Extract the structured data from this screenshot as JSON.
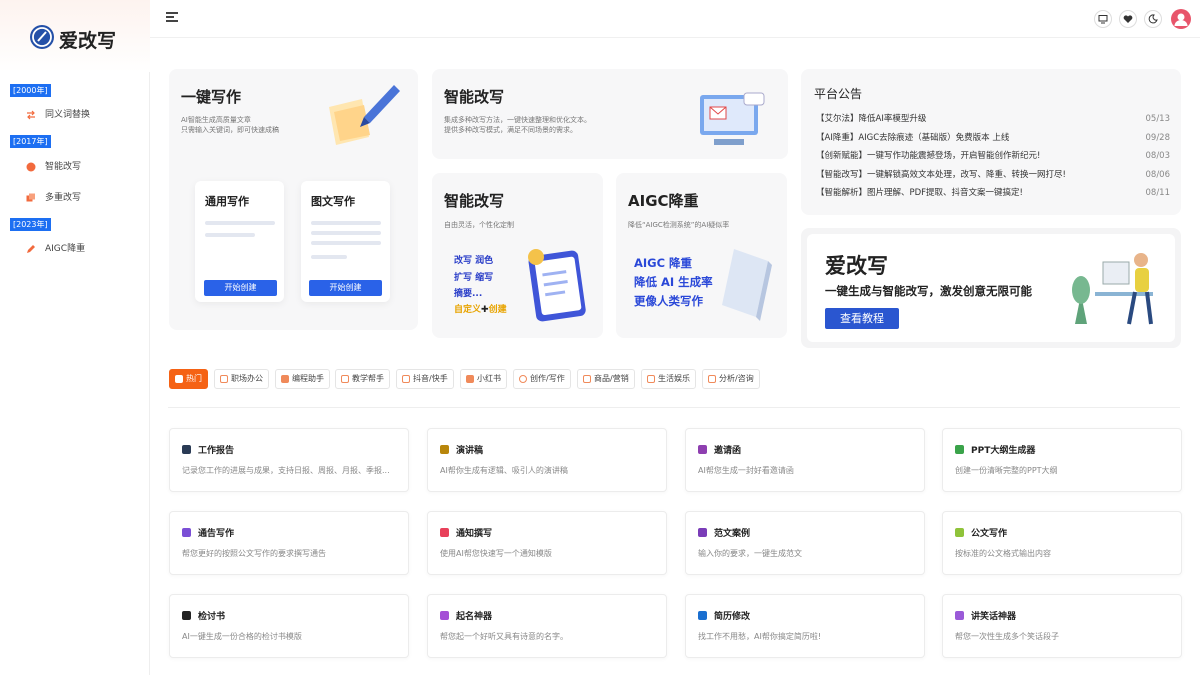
{
  "app": {
    "name": "爱改写"
  },
  "sidebar": {
    "groups": [
      {
        "tag": "[2000年]",
        "items": [
          {
            "label": "同义词替换",
            "icon": "swap-icon",
            "color": "#f26a3d"
          }
        ]
      },
      {
        "tag": "[2017年]",
        "items": [
          {
            "label": "智能改写",
            "icon": "brain-icon",
            "color": "#f26a3d"
          },
          {
            "label": "多重改写",
            "icon": "layers-icon",
            "color": "#f26a3d"
          }
        ]
      },
      {
        "tag": "[2023年]",
        "items": [
          {
            "label": "AIGC降重",
            "icon": "pencil-icon",
            "color": "#f26a3d"
          }
        ]
      }
    ]
  },
  "topbar": {
    "icons": [
      "menu-icon",
      "monitor-icon",
      "heart-icon",
      "moon-icon",
      "user-avatar-icon"
    ]
  },
  "hero": {
    "write": {
      "title": "一键写作",
      "sub1": "AI智能生成高质量文章",
      "sub2": "只需输入关键词，即可快速成稿",
      "cards": [
        {
          "title": "通用写作",
          "button": "开始创建"
        },
        {
          "title": "图文写作",
          "button": "开始创建"
        }
      ]
    },
    "rewrite_top": {
      "title": "智能改写",
      "sub1": "集成多种改写方法，一键快速整理和优化文本。",
      "sub2": "提供多种改写模式，满足不同场景的需求。"
    },
    "rewrite_small": {
      "title": "智能改写",
      "sub": "自由灵活，个性化定制",
      "lines": [
        "改写 润色",
        "扩写 缩写",
        "摘要...",
        "自定义",
        "创建"
      ]
    },
    "aigc": {
      "title": "AIGC降重",
      "sub": "降低“AIGC检测系统”的AI疑似率",
      "lines": [
        "AIGC 降重",
        "降低 AI 生成率",
        "更像人类写作"
      ]
    }
  },
  "announcements": {
    "title": "平台公告",
    "items": [
      {
        "text": "【艾尔法】降低AI率模型升级",
        "date": "05/13"
      },
      {
        "text": "【AI降重】AIGC去除痕迹（基础版）免费版本 上线",
        "date": "09/28"
      },
      {
        "text": "【创新赋能】一键写作功能震撼登场，开启智能创作新纪元!",
        "date": "08/03"
      },
      {
        "text": "【智能改写】一键解锁高效文本处理，改写、降重、转换一网打尽!",
        "date": "08/06"
      },
      {
        "text": "【智能解析】图片理解、PDF提取、抖音文案一键搞定!",
        "date": "08/11"
      }
    ]
  },
  "promo": {
    "title": "爱改写",
    "slogan": "一键生成与智能改写，激发创意无限可能",
    "button": "查看教程"
  },
  "categories": [
    {
      "label": "热门",
      "active": true
    },
    {
      "label": "职场办公"
    },
    {
      "label": "编程助手"
    },
    {
      "label": "教学帮手"
    },
    {
      "label": "抖音/快手"
    },
    {
      "label": "小红书"
    },
    {
      "label": "创作/写作"
    },
    {
      "label": "商品/营销"
    },
    {
      "label": "生活娱乐"
    },
    {
      "label": "分析/咨询"
    }
  ],
  "tools": [
    {
      "title": "工作报告",
      "desc": "记录您工作的进展与成果，支持日报、周报、月报、季报...",
      "icon": "report-icon",
      "color": "#2a3b55"
    },
    {
      "title": "演讲稿",
      "desc": "AI帮你生成有逻辑、吸引人的演讲稿",
      "icon": "speech-icon",
      "color": "#b8860b"
    },
    {
      "title": "邀请函",
      "desc": "AI帮您生成一封好看邀请函",
      "icon": "invitation-icon",
      "color": "#8e3fb0"
    },
    {
      "title": "PPT大纲生成器",
      "desc": "创建一份清晰完整的PPT大纲",
      "icon": "ppt-icon",
      "color": "#3aa34a"
    },
    {
      "title": "通告写作",
      "desc": "帮您更好的按照公文写作的要求撰写通告",
      "icon": "notice-icon",
      "color": "#7b4fd6"
    },
    {
      "title": "通知撰写",
      "desc": "使用AI帮您快速写一个通知模版",
      "icon": "notify-icon",
      "color": "#e8405a"
    },
    {
      "title": "范文案例",
      "desc": "输入你的要求，一键生成范文",
      "icon": "sample-icon",
      "color": "#7a3db8"
    },
    {
      "title": "公文写作",
      "desc": "按标准的公文格式输出内容",
      "icon": "document-icon",
      "color": "#8fc33a"
    },
    {
      "title": "检讨书",
      "desc": "AI一键生成一份合格的检讨书模版",
      "icon": "review-icon",
      "color": "#222222"
    },
    {
      "title": "起名神器",
      "desc": "帮您起一个好听又具有诗意的名字。",
      "icon": "naming-icon",
      "color": "#a44fd6"
    },
    {
      "title": "简历修改",
      "desc": "找工作不用愁，AI帮你搞定简历啦!",
      "icon": "resume-icon",
      "color": "#1a6fd0"
    },
    {
      "title": "讲笑话神器",
      "desc": "帮您一次性生成多个笑话段子",
      "icon": "joke-icon",
      "color": "#9a5ad8"
    }
  ],
  "colors": {
    "accent": "#2a62e8",
    "orange": "#f56214",
    "tag_blue": "#1d6ff2"
  }
}
